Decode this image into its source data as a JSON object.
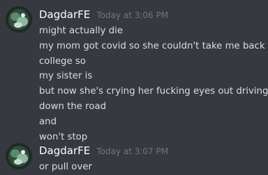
{
  "messages": [
    {
      "author": "DagdarFE",
      "timestamp": "Today at 3:06 PM",
      "lines": [
        "might actually die",
        "my mom got covid so she couldn't take me back to",
        "college so",
        "my sister is",
        "but now she's crying her fucking eyes out driving",
        "down the road",
        "and",
        "won't stop"
      ]
    },
    {
      "author": "DagdarFE",
      "timestamp": "Today at 3:07 PM",
      "lines": [
        "or pull over"
      ]
    }
  ],
  "colors": {
    "background": "#36393f",
    "username": "#ffffff",
    "timestamp": "#72767d",
    "message_text": "#dcddde"
  },
  "icons": {
    "avatar": "avatar-image"
  }
}
